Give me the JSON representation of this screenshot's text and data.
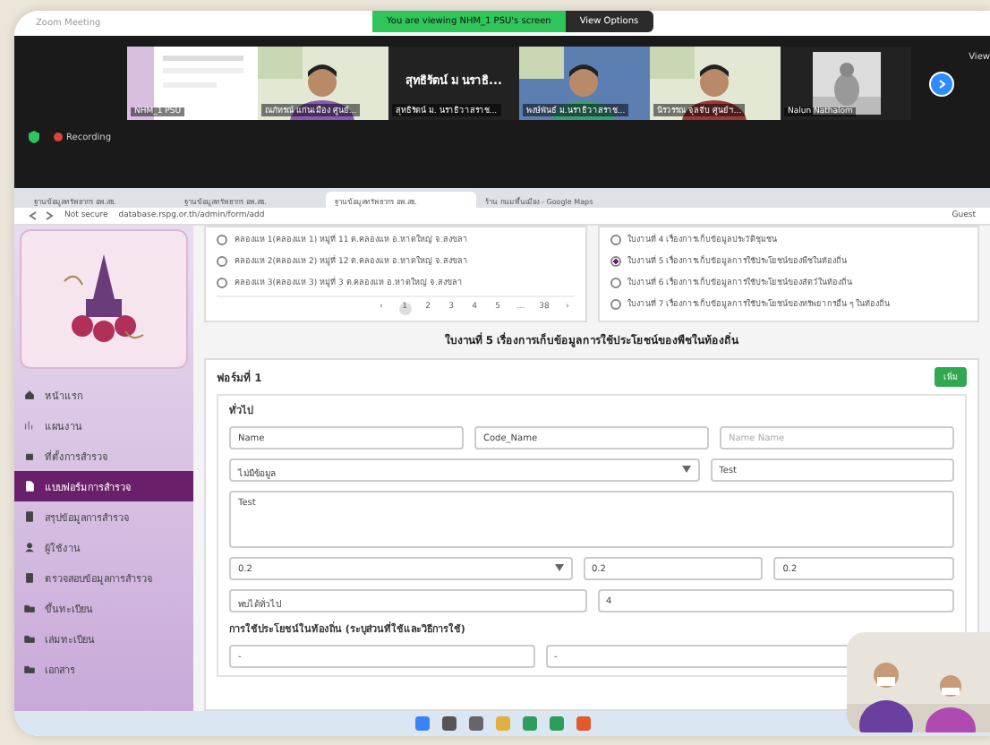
{
  "window": {
    "title": "Zoom Meeting"
  },
  "share_banner": {
    "text": "You are viewing NHM_1 PSU's screen",
    "button": "View Options"
  },
  "gallery": {
    "tiles": [
      {
        "kind": "screen",
        "name": "NHM_1 PSU"
      },
      {
        "kind": "person",
        "name": "ณภัทรณ์ แก่นเมือง ศูนย์..."
      },
      {
        "kind": "text",
        "name": "สุทธิรัตน์ ม. นราธิวาสราช...",
        "caption": "สุทธิรัตน์ ม นราธิ..."
      },
      {
        "kind": "person",
        "name": "พงษ์พันธ์ ม.นราธิวาสราช..."
      },
      {
        "kind": "person",
        "name": "นิรวรรณ จุลจีบ ศูนย์ฯ..."
      },
      {
        "name": "Nalun Nathalom"
      }
    ],
    "view_label": "View",
    "recording": "Recording"
  },
  "browser": {
    "tabs": [
      {
        "label": "ฐานข้อมูลทรัพยากร อพ.สธ.",
        "selected": false
      },
      {
        "label": "ฐานข้อมูลทรัพยากร อพ.สธ.",
        "selected": false
      },
      {
        "label": "ฐานข้อมูลทรัพยากร อพ.สธ.",
        "selected": true
      },
      {
        "label": "ร้าน กนมพื้นเมือง - Google Maps",
        "selected": false
      }
    ],
    "security": "Not secure",
    "url": "database.rspg.or.th/admin/form/add",
    "profile": "Guest"
  },
  "sidebar": {
    "items": [
      {
        "label": "หน้าแรก",
        "selected": false
      },
      {
        "label": "แผนงาน",
        "selected": false
      },
      {
        "label": "ที่ตั้งการสำรวจ",
        "selected": false
      },
      {
        "label": "แบบฟอร์มการสำรวจ",
        "selected": true
      },
      {
        "label": "สรุปข้อมูลการสำรวจ",
        "selected": false
      },
      {
        "label": "ผู้ใช้งาน",
        "selected": false
      },
      {
        "label": "ตรวจสอบข้อมูลการสำรวจ",
        "selected": false
      },
      {
        "label": "ขึ้นทะเบียน",
        "selected": false
      },
      {
        "label": "เล่มทะเบียน",
        "selected": false
      },
      {
        "label": "เอกสาร",
        "selected": false
      }
    ]
  },
  "locations": {
    "options": [
      {
        "label": "คลองแห 1(คลองแห 1) หมู่ที่ 11 ต.คลองแห อ.หาดใหญ่ จ.สงขลา",
        "selected": false
      },
      {
        "label": "คลองแห 2(คลองแห 2) หมู่ที่ 12 ต.คลองแห อ.หาดใหญ่ จ.สงขลา",
        "selected": false
      },
      {
        "label": "คลองแห 3(คลองแห 3) หมู่ที่ 3 ต.คลองแห อ.หาดใหญ่ จ.สงขลา",
        "selected": false
      }
    ],
    "pages": [
      {
        "label": "‹",
        "selected": false
      },
      {
        "label": "1",
        "selected": true
      },
      {
        "label": "2",
        "selected": false
      },
      {
        "label": "3",
        "selected": false
      },
      {
        "label": "4",
        "selected": false
      },
      {
        "label": "5",
        "selected": false
      },
      {
        "label": "...",
        "selected": false
      },
      {
        "label": "38",
        "selected": false
      },
      {
        "label": "›",
        "selected": false
      }
    ]
  },
  "worksheets": {
    "options": [
      {
        "label": "ใบงานที่ 4 เรื่องการเก็บข้อมูลประวัติชุมชน",
        "selected": false
      },
      {
        "label": "ใบงานที่ 5 เรื่องการเก็บข้อมูลการใช้ประโยชน์ของพืชในท้องถิ่น",
        "selected": true
      },
      {
        "label": "ใบงานที่ 6 เรื่องการเก็บข้อมูลการใช้ประโยชน์ของสัตว์ในท้องถิ่น",
        "selected": false
      },
      {
        "label": "ใบงานที่ 7 เรื่องการเก็บข้อมูลการใช้ประโยชน์ของทรัพยากรอื่น ๆ ในท้องถิ่น",
        "selected": false
      }
    ]
  },
  "form": {
    "heading": "ใบงานที่ 5 เรื่องการเก็บข้อมูลการใช้ประโยชน์ของพืชในท้องถิ่น",
    "title": "ฟอร์มที่ 1",
    "add_button": "เพิ่ม",
    "section": "ทั่วไป",
    "rows": [
      [
        {
          "kind": "input",
          "value": "Name"
        },
        {
          "kind": "input",
          "value": "Code_Name"
        },
        {
          "kind": "input",
          "placeholder": "Name Name"
        }
      ],
      [
        {
          "kind": "select",
          "value": "ไม่มีข้อมูล"
        },
        {
          "kind": "input",
          "value": "Test"
        }
      ],
      [
        {
          "kind": "textarea",
          "value": "Test"
        }
      ],
      [
        {
          "kind": "select",
          "value": "0.2"
        },
        {
          "kind": "input",
          "value": "0.2"
        },
        {
          "kind": "input",
          "value": "0.2"
        }
      ],
      [
        {
          "kind": "input",
          "value": "พบได้ทั่วไป"
        },
        {
          "kind": "input",
          "value": "4"
        }
      ]
    ],
    "usage_title": "การใช้ประโยชน์ในท้องถิ่น (ระบุส่วนที่ใช้และวิธีการใช้)",
    "usage_row": [
      {
        "kind": "input",
        "value": "-"
      },
      {
        "kind": "input",
        "value": "-"
      }
    ]
  }
}
